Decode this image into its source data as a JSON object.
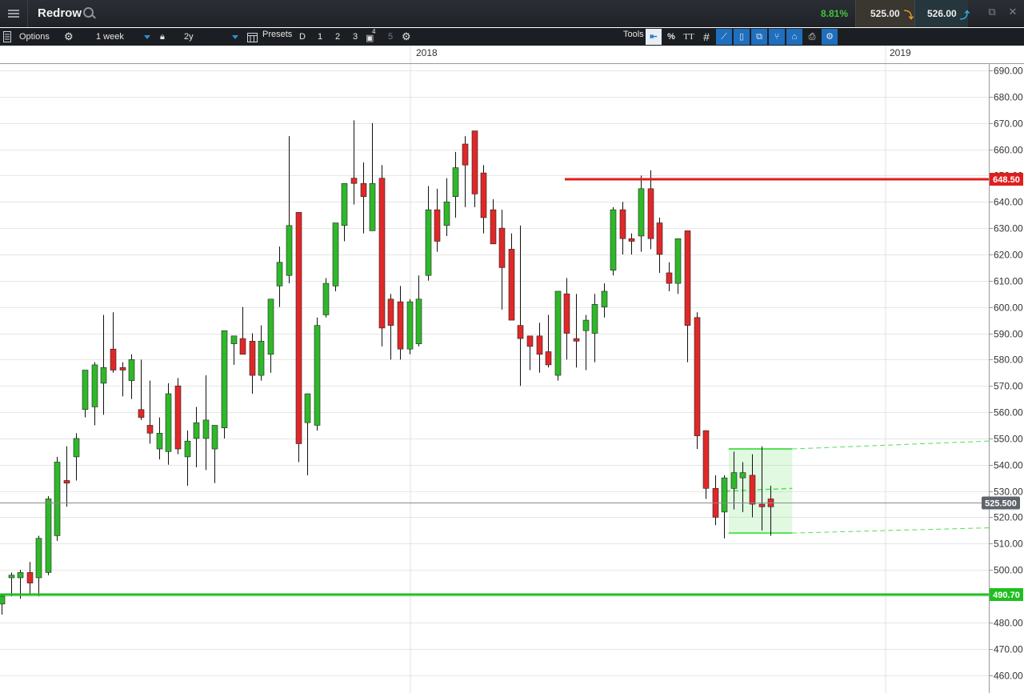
{
  "header": {
    "instrument": "Redrow",
    "change_pct": "8.81%",
    "sell_price": "525.00",
    "buy_price": "526.00"
  },
  "toolbar": {
    "options_label": "Options",
    "interval_value": "1 week",
    "range_value": "2y",
    "presets_label": "Presets",
    "preset_d": "D",
    "preset_1": "1",
    "preset_2": "2",
    "preset_3": "3",
    "preset_4": "4",
    "preset_5": "5",
    "tools_label": "Tools",
    "percent_label": "%",
    "text_tool_label": "TT"
  },
  "colors": {
    "up": "#2fb82a",
    "down": "#e02828",
    "resistance": "#e01e1e",
    "support": "#1fbf1f",
    "channel": "#55e055"
  },
  "chart_data": {
    "type": "candlestick",
    "interval": "1 week",
    "x_labels": [
      "2018",
      "2019"
    ],
    "y_ticks": [
      460,
      470,
      480,
      490,
      500,
      510,
      520,
      530,
      540,
      550,
      560,
      570,
      580,
      590,
      600,
      610,
      620,
      630,
      640,
      650,
      660,
      670,
      680,
      690
    ],
    "y_tick_labels": [
      "460.00",
      "470.00",
      "480.00",
      "490.00",
      "500.00",
      "510.00",
      "520.00",
      "530.00",
      "540.00",
      "550.00",
      "560.00",
      "570.00",
      "580.00",
      "590.00",
      "600.00",
      "610.00",
      "620.00",
      "630.00",
      "640.00",
      "650.00",
      "660.00",
      "670.00",
      "680.00",
      "690.00"
    ],
    "ylim": [
      457,
      692
    ],
    "current_price": 525.5,
    "current_price_label": "525.500",
    "resistance_level": 648.5,
    "resistance_label": "648.50",
    "support_level": 490.7,
    "support_label": "490.70",
    "candles": [
      {
        "o": 487,
        "h": 491,
        "l": 483,
        "c": 490
      },
      {
        "o": 497,
        "h": 499,
        "l": 490,
        "c": 498
      },
      {
        "o": 497,
        "h": 500,
        "l": 489,
        "c": 499
      },
      {
        "o": 499,
        "h": 503,
        "l": 491,
        "c": 495
      },
      {
        "o": 497,
        "h": 513,
        "l": 490,
        "c": 512
      },
      {
        "o": 499,
        "h": 528,
        "l": 498,
        "c": 527
      },
      {
        "o": 513,
        "h": 543,
        "l": 511,
        "c": 541
      },
      {
        "o": 534,
        "h": 547,
        "l": 524,
        "c": 533
      },
      {
        "o": 543,
        "h": 552,
        "l": 534,
        "c": 550
      },
      {
        "o": 561,
        "h": 567,
        "l": 558,
        "c": 576
      },
      {
        "o": 562,
        "h": 579,
        "l": 555,
        "c": 578
      },
      {
        "o": 571,
        "h": 597,
        "l": 559,
        "c": 577
      },
      {
        "o": 584,
        "h": 598,
        "l": 575,
        "c": 576
      },
      {
        "o": 577,
        "h": 579,
        "l": 566,
        "c": 576
      },
      {
        "o": 572,
        "h": 582,
        "l": 565,
        "c": 580
      },
      {
        "o": 561,
        "h": 580,
        "l": 557,
        "c": 558
      },
      {
        "o": 555,
        "h": 572,
        "l": 548,
        "c": 552
      },
      {
        "o": 546,
        "h": 558,
        "l": 542,
        "c": 552
      },
      {
        "o": 545,
        "h": 571,
        "l": 540,
        "c": 567
      },
      {
        "o": 570,
        "h": 573,
        "l": 544,
        "c": 546
      },
      {
        "o": 543,
        "h": 553,
        "l": 532,
        "c": 549
      },
      {
        "o": 550,
        "h": 562,
        "l": 539,
        "c": 556
      },
      {
        "o": 550,
        "h": 574,
        "l": 538,
        "c": 557
      },
      {
        "o": 546,
        "h": 555,
        "l": 533,
        "c": 555
      },
      {
        "o": 554,
        "h": 590,
        "l": 550,
        "c": 591
      },
      {
        "o": 586,
        "h": 589,
        "l": 578,
        "c": 589
      },
      {
        "o": 588,
        "h": 600,
        "l": 588,
        "c": 582
      },
      {
        "o": 587,
        "h": 590,
        "l": 567,
        "c": 574
      },
      {
        "o": 574,
        "h": 593,
        "l": 572,
        "c": 587
      },
      {
        "o": 582,
        "h": 602,
        "l": 575,
        "c": 603
      },
      {
        "o": 608,
        "h": 623,
        "l": 600,
        "c": 617
      },
      {
        "o": 612,
        "h": 665,
        "l": 609,
        "c": 631
      },
      {
        "o": 636,
        "h": 636,
        "l": 541,
        "c": 548
      },
      {
        "o": 556,
        "h": 567,
        "l": 536,
        "c": 567
      },
      {
        "o": 555,
        "h": 596,
        "l": 553,
        "c": 593
      },
      {
        "o": 597,
        "h": 611,
        "l": 596,
        "c": 609
      },
      {
        "o": 608,
        "h": 632,
        "l": 606,
        "c": 632
      },
      {
        "o": 631,
        "h": 643,
        "l": 625,
        "c": 647
      },
      {
        "o": 649,
        "h": 671,
        "l": 639,
        "c": 647
      },
      {
        "o": 647,
        "h": 655,
        "l": 628,
        "c": 642
      },
      {
        "o": 629,
        "h": 670,
        "l": 633,
        "c": 647
      },
      {
        "o": 649,
        "h": 654,
        "l": 585,
        "c": 592
      },
      {
        "o": 603,
        "h": 605,
        "l": 580,
        "c": 593
      },
      {
        "o": 602,
        "h": 608,
        "l": 580,
        "c": 584
      },
      {
        "o": 584,
        "h": 603,
        "l": 582,
        "c": 602
      },
      {
        "o": 586,
        "h": 612,
        "l": 585,
        "c": 603
      },
      {
        "o": 612,
        "h": 646,
        "l": 610,
        "c": 637
      },
      {
        "o": 637,
        "h": 645,
        "l": 621,
        "c": 625
      },
      {
        "o": 631,
        "h": 649,
        "l": 627,
        "c": 640
      },
      {
        "o": 642,
        "h": 659,
        "l": 634,
        "c": 653
      },
      {
        "o": 662,
        "h": 665,
        "l": 638,
        "c": 654
      },
      {
        "o": 667,
        "h": 665,
        "l": 638,
        "c": 643
      },
      {
        "o": 651,
        "h": 654,
        "l": 628,
        "c": 634
      },
      {
        "o": 637,
        "h": 641,
        "l": 630,
        "c": 624
      },
      {
        "o": 630,
        "h": 637,
        "l": 599,
        "c": 615
      },
      {
        "o": 622,
        "h": 628,
        "l": 597,
        "c": 595
      },
      {
        "o": 593,
        "h": 631,
        "l": 570,
        "c": 588
      },
      {
        "o": 589,
        "h": 586,
        "l": 576,
        "c": 585
      },
      {
        "o": 589,
        "h": 594,
        "l": 575,
        "c": 582
      },
      {
        "o": 583,
        "h": 597,
        "l": 577,
        "c": 578
      },
      {
        "o": 574,
        "h": 606,
        "l": 572,
        "c": 606
      },
      {
        "o": 605,
        "h": 611,
        "l": 580,
        "c": 590
      },
      {
        "o": 588,
        "h": 605,
        "l": 577,
        "c": 587
      },
      {
        "o": 591,
        "h": 597,
        "l": 576,
        "c": 595
      },
      {
        "o": 590,
        "h": 605,
        "l": 579,
        "c": 601
      },
      {
        "o": 600,
        "h": 609,
        "l": 596,
        "c": 606
      },
      {
        "o": 614,
        "h": 638,
        "l": 612,
        "c": 637
      },
      {
        "o": 637,
        "h": 640,
        "l": 620,
        "c": 626
      },
      {
        "o": 626,
        "h": 628,
        "l": 620,
        "c": 625
      },
      {
        "o": 627,
        "h": 650,
        "l": 621,
        "c": 645
      },
      {
        "o": 645,
        "h": 652,
        "l": 622,
        "c": 626
      },
      {
        "o": 632,
        "h": 634,
        "l": 613,
        "c": 620
      },
      {
        "o": 613,
        "h": 617,
        "l": 606,
        "c": 609
      },
      {
        "o": 609,
        "h": 626,
        "l": 605,
        "c": 626
      },
      {
        "o": 629,
        "h": 628,
        "l": 579,
        "c": 593
      },
      {
        "o": 596,
        "h": 598,
        "l": 546,
        "c": 551
      },
      {
        "o": 553,
        "h": 553,
        "l": 527,
        "c": 531
      },
      {
        "o": 531,
        "h": 536,
        "l": 517,
        "c": 520
      },
      {
        "o": 522,
        "h": 536,
        "l": 512,
        "c": 535
      },
      {
        "o": 531,
        "h": 545,
        "l": 523,
        "c": 537
      },
      {
        "o": 535,
        "h": 541,
        "l": 522,
        "c": 537
      },
      {
        "o": 536,
        "h": 544,
        "l": 520,
        "c": 525
      },
      {
        "o": 525,
        "h": 547,
        "l": 515,
        "c": 524
      },
      {
        "o": 527,
        "h": 532,
        "l": 513,
        "c": 524
      }
    ],
    "channel_box": {
      "x_start_index": 79,
      "x_end_index": 85,
      "top": 546,
      "bottom": 514,
      "mid": 530
    },
    "channel_projection": {
      "upper": [
        546,
        549
      ],
      "lower": [
        514,
        516
      ]
    }
  }
}
